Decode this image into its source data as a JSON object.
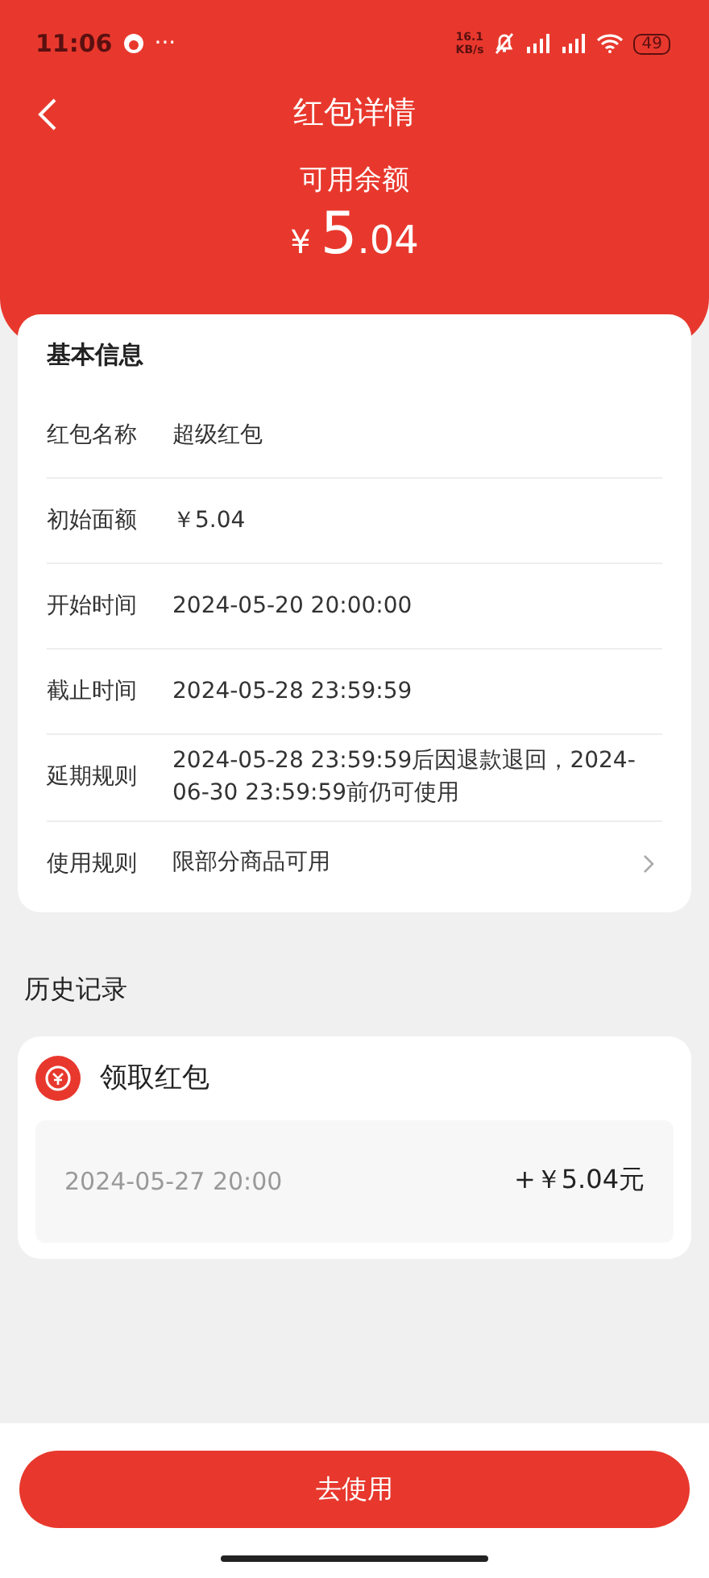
{
  "status_bar": {
    "time": "11:06",
    "more": "···",
    "speed": "16.1",
    "speed_unit": "KB/s",
    "battery": "49"
  },
  "header": {
    "title": "红包详情",
    "balance_label": "可用余额",
    "currency": "¥",
    "amount_int": "5",
    "amount_dec": ".04"
  },
  "info_card": {
    "title": "基本信息",
    "rows": [
      {
        "label": "红包名称",
        "value": "超级红包",
        "has_arrow": false
      },
      {
        "label": "初始面额",
        "value": "￥5.04",
        "has_arrow": false
      },
      {
        "label": "开始时间",
        "value": "2024-05-20 20:00:00",
        "has_arrow": false
      },
      {
        "label": "截止时间",
        "value": "2024-05-28 23:59:59",
        "has_arrow": false
      },
      {
        "label": "延期规则",
        "value": "2024-05-28 23:59:59后因退款退回，2024-06-30 23:59:59前仍可使用",
        "has_arrow": false
      },
      {
        "label": "使用规则",
        "value": "限部分商品可用",
        "has_arrow": true
      }
    ]
  },
  "history": {
    "title": "历史记录",
    "records": [
      {
        "type": "领取红包",
        "time": "2024-05-27 20:00",
        "amount": "+￥5.04元"
      }
    ]
  },
  "use_button": "去使用"
}
